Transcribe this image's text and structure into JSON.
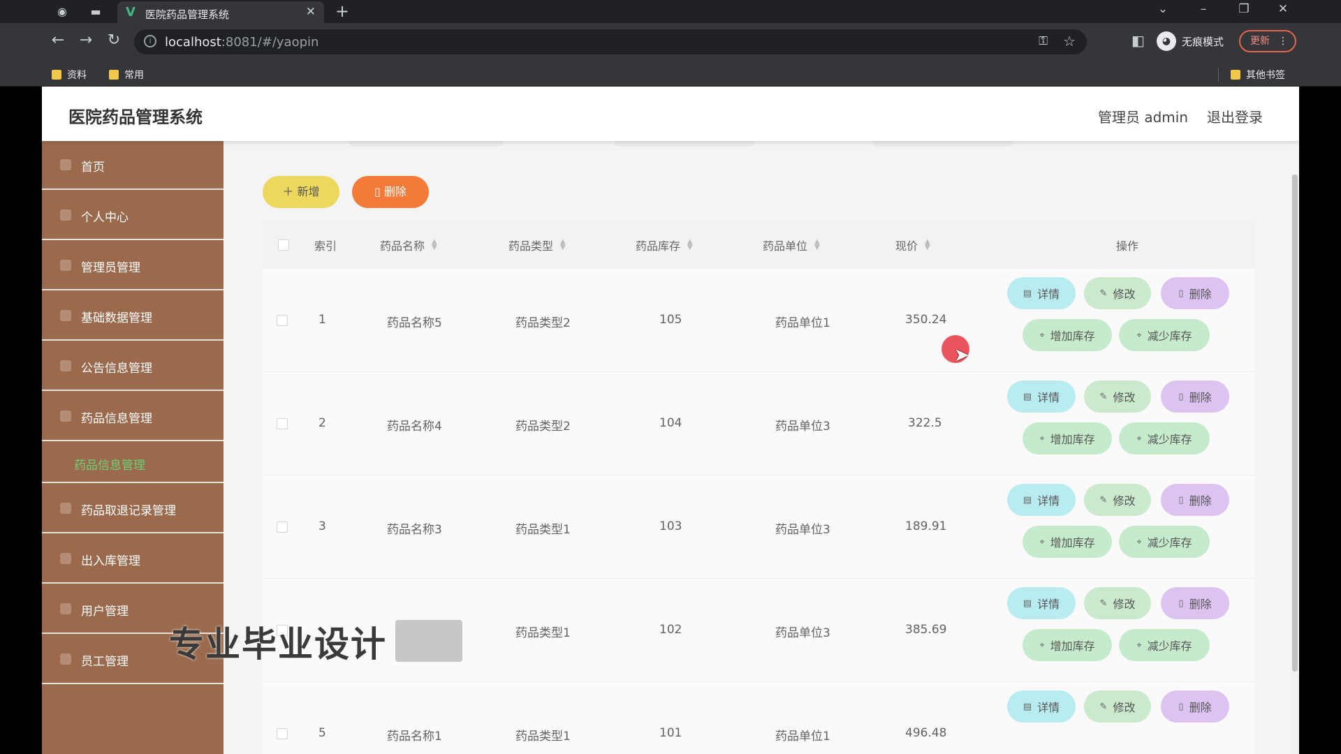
{
  "browser": {
    "tab_title": "医院药品管理系统",
    "url_host": "localhost",
    "url_rest": ":8081/#/yaopin",
    "incognito_label": "无痕模式",
    "update_label": "更新",
    "bookmarks": [
      "资料",
      "常用"
    ],
    "other_bookmarks": "其他书签"
  },
  "app": {
    "title": "医院药品管理系统",
    "admin_label": "管理员 admin",
    "logout_label": "退出登录"
  },
  "sidebar": {
    "items": [
      {
        "label": "首页"
      },
      {
        "label": "个人中心"
      },
      {
        "label": "管理员管理"
      },
      {
        "label": "基础数据管理"
      },
      {
        "label": "公告信息管理"
      },
      {
        "label": "药品信息管理"
      },
      {
        "label": "药品取退记录管理"
      },
      {
        "label": "出入库管理"
      },
      {
        "label": "用户管理"
      },
      {
        "label": "员工管理"
      }
    ],
    "active_sub": "药品信息管理"
  },
  "toolbar": {
    "add_label": "新增",
    "delete_label": "删除"
  },
  "table": {
    "headers": {
      "index": "索引",
      "name": "药品名称",
      "type": "药品类型",
      "stock": "药品库存",
      "unit": "药品单位",
      "price": "现价",
      "actions": "操作"
    },
    "actions": {
      "detail": "详情",
      "edit": "修改",
      "delete": "删除",
      "increase": "增加库存",
      "decrease": "减少库存"
    },
    "rows": [
      {
        "index": "1",
        "name": "药品名称5",
        "type": "药品类型2",
        "stock": "105",
        "unit": "药品单位1",
        "price": "350.24"
      },
      {
        "index": "2",
        "name": "药品名称4",
        "type": "药品类型2",
        "stock": "104",
        "unit": "药品单位3",
        "price": "322.5"
      },
      {
        "index": "3",
        "name": "药品名称3",
        "type": "药品类型1",
        "stock": "103",
        "unit": "药品单位3",
        "price": "189.91"
      },
      {
        "index": "",
        "name": "",
        "type": "药品类型1",
        "stock": "102",
        "unit": "药品单位3",
        "price": "385.69"
      },
      {
        "index": "5",
        "name": "药品名称1",
        "type": "药品类型1",
        "stock": "101",
        "unit": "药品单位1",
        "price": "496.48"
      }
    ]
  },
  "watermark": "专业毕业设计"
}
